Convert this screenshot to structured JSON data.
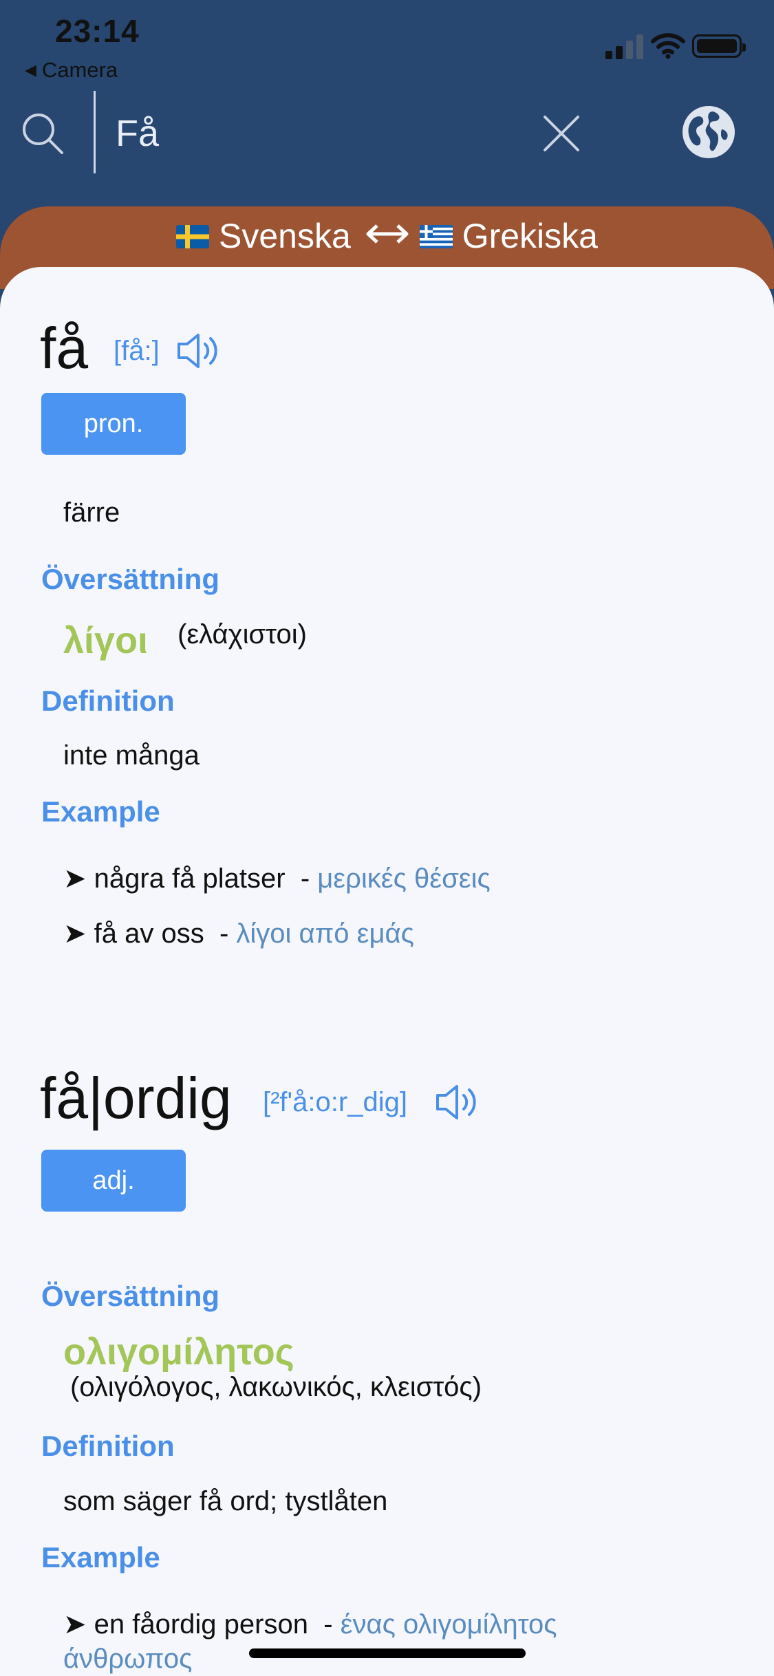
{
  "status_bar": {
    "time": "23:14",
    "back_app": "Camera"
  },
  "search": {
    "value": "Få"
  },
  "languages": {
    "source": "Svenska",
    "target": "Grekiska"
  },
  "entries": [
    {
      "headword": "få",
      "phonetic": "[få:]",
      "pos": "pron.",
      "form": "färre",
      "translation_header": "Översättning",
      "translation": "λίγοι",
      "synonyms": "(ελάχιστοι)",
      "definition_header": "Definition",
      "definition": "inte många",
      "example_header": "Example",
      "examples": [
        {
          "sv": "➤ några få platser",
          "gr": "μερικές θέσεις"
        },
        {
          "sv": "➤ få av oss",
          "gr": "λίγοι από εμάς"
        }
      ]
    },
    {
      "headword": "få|ordig",
      "phonetic": "[²f'å:o:r_dig]",
      "pos": "adj.",
      "translation_header": "Översättning",
      "translation": "ολιγομίλητος",
      "synonyms": "(ολιγόλογος, λακωνικός, κλειστός)",
      "definition_header": "Definition",
      "definition": "som säger få ord; tystlåten",
      "example_header": "Example",
      "examples": [
        {
          "sv": "➤ en fåordig person",
          "gr": "ένας ολιγομίλητος άνθρωπος"
        }
      ]
    }
  ]
}
